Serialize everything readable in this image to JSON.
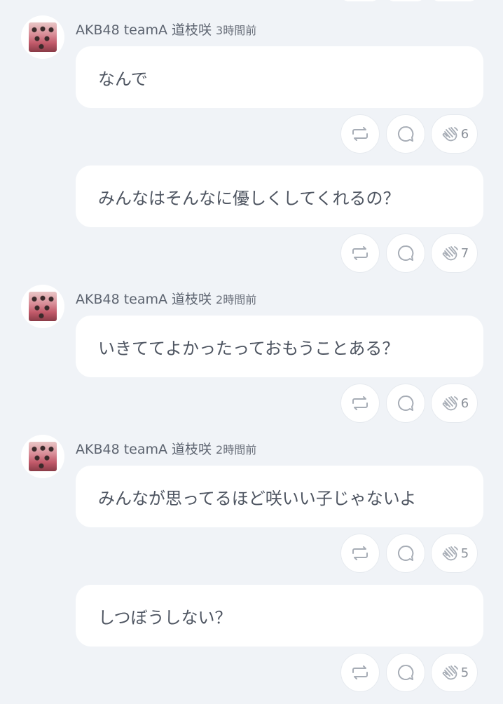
{
  "colors": {
    "background": "#f0f3f7",
    "bubble": "#ffffff",
    "text": "#4e5561",
    "icon": "#a7adb6"
  },
  "icons": {
    "retweet": "retweet-icon",
    "reply": "speech-bubble-icon",
    "clap": "clap-icon"
  },
  "posts": [
    {
      "author": "AKB48 teamA 道枝咲",
      "time": "3時間前",
      "messages": [
        {
          "text": "なんで",
          "claps": "6"
        },
        {
          "text": "みんなはそんなに優しくしてくれるの？",
          "claps": "7"
        }
      ]
    },
    {
      "author": "AKB48 teamA 道枝咲",
      "time": "2時間前",
      "messages": [
        {
          "text": "いきててよかったっておもうことある？",
          "claps": "6"
        }
      ]
    },
    {
      "author": "AKB48 teamA 道枝咲",
      "time": "2時間前",
      "messages": [
        {
          "text": "みんなが思ってるほど咲いい子じゃないよ",
          "claps": "5"
        },
        {
          "text": "しつぼうしない？",
          "claps": "5"
        }
      ]
    }
  ]
}
